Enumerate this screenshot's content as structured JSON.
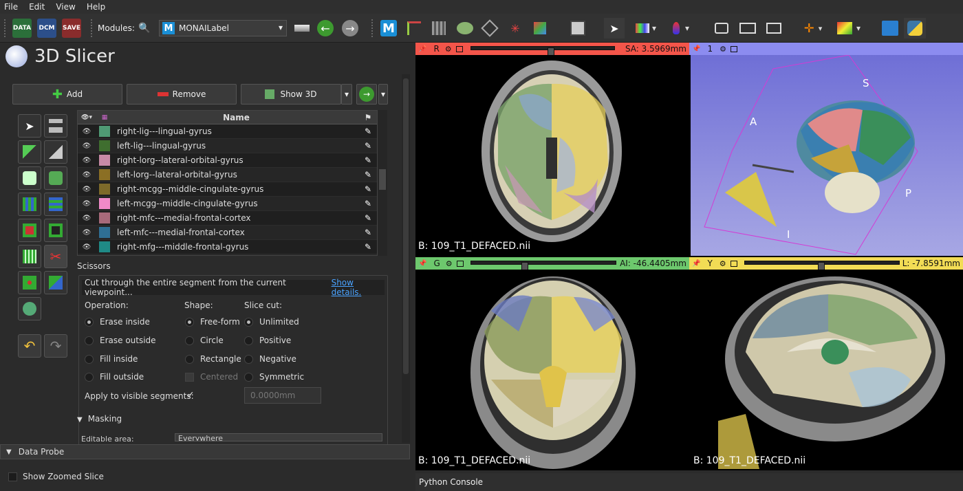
{
  "menu": [
    "File",
    "Edit",
    "View",
    "Help"
  ],
  "toolbar": {
    "data": "DATA",
    "dcm": "DCM",
    "save": "SAVE",
    "modules_label": "Modules:",
    "module": "MONAILabel",
    "module_logo": "M"
  },
  "app": {
    "title": "3D Slicer"
  },
  "seg_buttons": {
    "add": "Add",
    "remove": "Remove",
    "show3d": "Show 3D"
  },
  "table": {
    "header": "Name",
    "rows": [
      {
        "name": "right-lig---lingual-gyrus",
        "color": "#4f9a74"
      },
      {
        "name": "left-lig---lingual-gyrus",
        "color": "#3f6e2f"
      },
      {
        "name": "right-lorg--lateral-orbital-gyrus",
        "color": "#c78aa6"
      },
      {
        "name": "left-lorg--lateral-orbital-gyrus",
        "color": "#8b6f24"
      },
      {
        "name": "right-mcgg--middle-cingulate-gyrus",
        "color": "#7d6a2a"
      },
      {
        "name": "left-mcgg--middle-cingulate-gyrus",
        "color": "#f08ac8"
      },
      {
        "name": "right-mfc---medial-frontal-cortex",
        "color": "#a76a7a"
      },
      {
        "name": "left-mfc---medial-frontal-cortex",
        "color": "#2f6f94"
      },
      {
        "name": "right-mfg---middle-frontal-gyrus",
        "color": "#1f8a86"
      }
    ]
  },
  "scissors": {
    "title": "Scissors",
    "description": "Cut through the entire segment from the current viewpoint...",
    "details": "Show details.",
    "operation": "Operation:",
    "shape": "Shape:",
    "slicecut": "Slice cut:",
    "op": [
      "Erase inside",
      "Erase outside",
      "Fill inside",
      "Fill outside"
    ],
    "sh": [
      "Free-form",
      "Circle",
      "Rectangle",
      "Centered"
    ],
    "sc": [
      "Unlimited",
      "Positive",
      "Negative",
      "Symmetric"
    ],
    "apply": "Apply to visible segments:",
    "check": "✓",
    "thickness": "0.0000mm"
  },
  "masking": {
    "title": "Masking",
    "editable": "Editable area:",
    "value": "Everywhere"
  },
  "probe": "Data Probe",
  "zoom": "Show Zoomed Slice",
  "views": {
    "red": {
      "letter": "R",
      "value": "SA: 3.5969mm",
      "label": "B: 109_T1_DEFACED.nii",
      "slider": 0.55,
      "color": "#f4554a"
    },
    "three": {
      "letter": "1",
      "color": "#8c8cf0",
      "labels": {
        "s": "S",
        "a": "A",
        "i": "I",
        "p": "P"
      }
    },
    "green": {
      "letter": "G",
      "value": "AI: -46.4405mm",
      "label": "B: 109_T1_DEFACED.nii",
      "slider": 0.37,
      "color": "#6dc86d"
    },
    "yellow": {
      "letter": "Y",
      "value": "L: -7.8591mm",
      "label": "B: 109_T1_DEFACED.nii",
      "slider": 0.49,
      "color": "#f2dc55"
    }
  },
  "python": "Python Console"
}
